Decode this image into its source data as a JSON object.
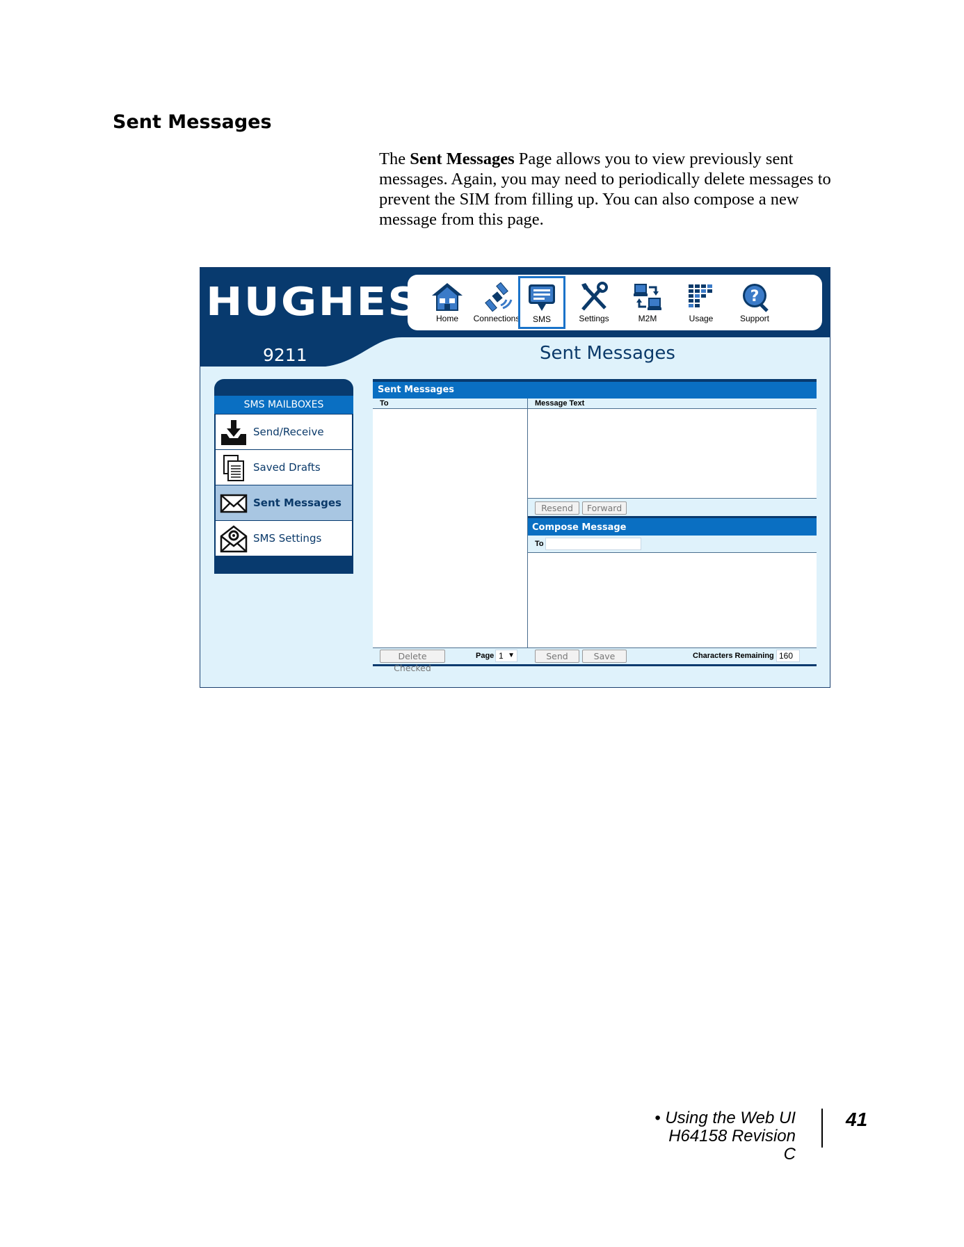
{
  "doc": {
    "heading": "Sent Messages",
    "intro_pre": "The ",
    "intro_bold": "Sent Messages",
    "intro_post": " Page allows you to view previously sent messages.  Again, you may need to periodically delete messages to prevent the SIM from filling up.  You can also compose a new message from this page.",
    "footer_section": "• Using the Web UI",
    "footer_doc": "H64158  Revision C",
    "page_number": "41"
  },
  "app": {
    "logo": "HUGHES",
    "model": "9211",
    "page_title": "Sent Messages",
    "nav": [
      {
        "label": "Home",
        "icon": "home-icon"
      },
      {
        "label": "Connections",
        "icon": "satellite-icon"
      },
      {
        "label": "SMS",
        "icon": "sms-icon",
        "active": true
      },
      {
        "label": "Settings",
        "icon": "tools-icon"
      },
      {
        "label": "M2M",
        "icon": "m2m-icon"
      },
      {
        "label": "Usage",
        "icon": "usage-icon"
      },
      {
        "label": "Support",
        "icon": "support-icon"
      }
    ],
    "mailbox": {
      "title": "SMS MAILBOXES",
      "items": [
        {
          "label": "Send/Receive",
          "icon": "inbox-download-icon"
        },
        {
          "label": "Saved Drafts",
          "icon": "drafts-icon"
        },
        {
          "label": "Sent Messages",
          "icon": "envelope-icon",
          "active": true
        },
        {
          "label": "SMS Settings",
          "icon": "envelope-gear-icon"
        }
      ]
    },
    "sent": {
      "title": "Sent Messages",
      "col_to": "To",
      "col_text": "Message Text",
      "resend": "Resend",
      "forward": "Forward",
      "delete_checked": "Delete Checked",
      "page_label": "Page",
      "page_value": "1"
    },
    "compose": {
      "title": "Compose Message",
      "to_label": "To",
      "to_value": "",
      "send": "Send",
      "save": "Save",
      "chars_label": "Characters Remaining",
      "chars_value": "160"
    },
    "colors": {
      "navy": "#083a6e",
      "blue": "#0a6fc2",
      "light": "#dff2fb"
    }
  }
}
